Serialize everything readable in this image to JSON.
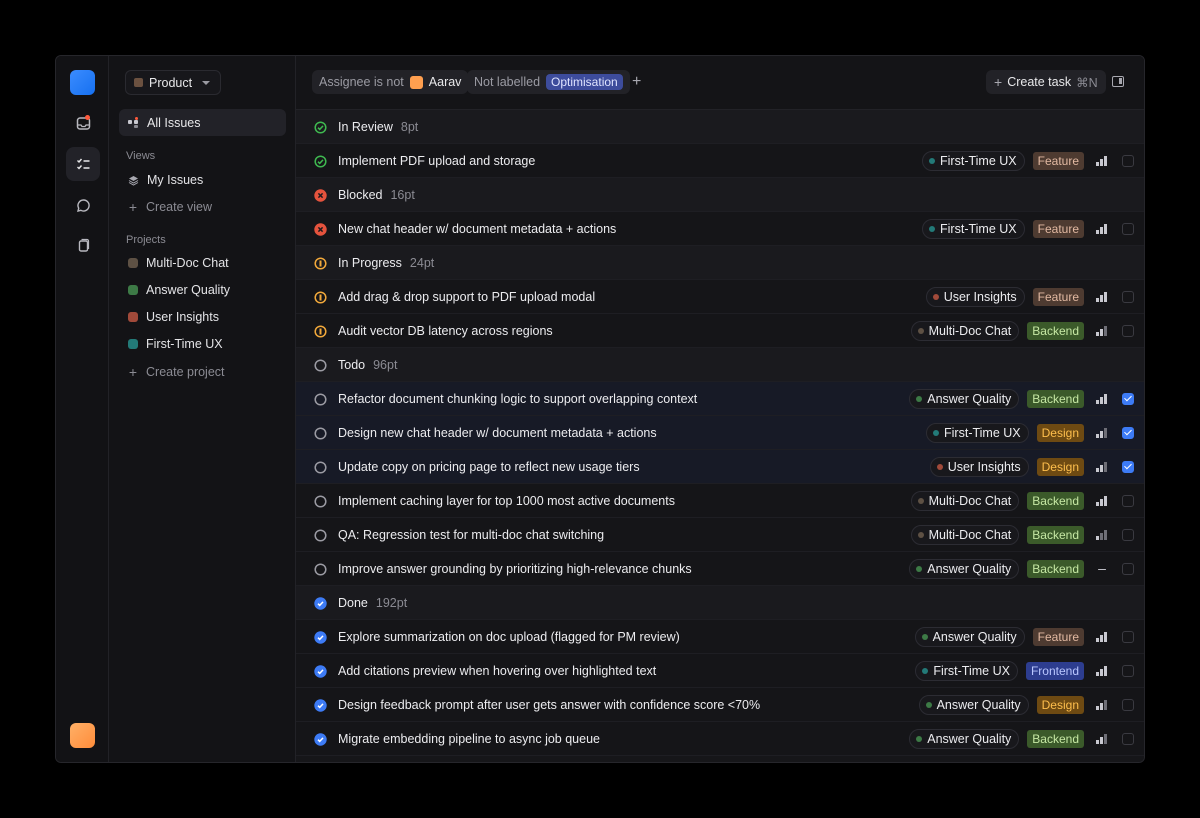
{
  "sidebar": {
    "team": "Product",
    "all_issues": "All Issues",
    "views_label": "Views",
    "my_issues": "My Issues",
    "create_view": "Create view",
    "projects_label": "Projects",
    "projects": [
      {
        "name": "Multi-Doc Chat",
        "color": "#5e5144"
      },
      {
        "name": "Answer Quality",
        "color": "#3d7a46"
      },
      {
        "name": "User Insights",
        "color": "#a14a3a"
      },
      {
        "name": "First-Time UX",
        "color": "#237a78"
      }
    ],
    "create_project": "Create project"
  },
  "toolbar": {
    "filter1_prefix": "Assignee is not",
    "filter1_value": "Aarav",
    "filter2_prefix": "Not labelled",
    "filter2_value": "Optimisation",
    "create_task": "Create task",
    "create_task_kbd": "⌘N"
  },
  "colors": {
    "accent": "#3d7bf5"
  },
  "rows": [
    {
      "kind": "group",
      "status": "review",
      "title": "In Review",
      "points": "8pt"
    },
    {
      "kind": "task",
      "status": "review",
      "title": "Implement PDF upload and storage",
      "project": "First-Time UX",
      "pcolor": "#237a78",
      "label": "Feature",
      "lbl": "feature",
      "prio": 3,
      "checked": false
    },
    {
      "kind": "group",
      "status": "blocked",
      "title": "Blocked",
      "points": "16pt"
    },
    {
      "kind": "task",
      "status": "blocked",
      "title": "New chat header w/ document metadata + actions",
      "project": "First-Time UX",
      "pcolor": "#237a78",
      "label": "Feature",
      "lbl": "feature",
      "prio": 3,
      "checked": false
    },
    {
      "kind": "group",
      "status": "progress",
      "title": "In Progress",
      "points": "24pt"
    },
    {
      "kind": "task",
      "status": "progress",
      "title": "Add drag & drop support to PDF upload modal",
      "project": "User Insights",
      "pcolor": "#a14a3a",
      "label": "Feature",
      "lbl": "feature",
      "prio": 3,
      "checked": false
    },
    {
      "kind": "task",
      "status": "progress",
      "title": "Audit vector DB latency across regions",
      "project": "Multi-Doc Chat",
      "pcolor": "#5e5144",
      "label": "Backend",
      "lbl": "backend",
      "prio": 2,
      "checked": false
    },
    {
      "kind": "group",
      "status": "todo",
      "title": "Todo",
      "points": "96pt"
    },
    {
      "kind": "task",
      "status": "todo",
      "title": "Refactor document chunking logic to support overlapping context",
      "project": "Answer Quality",
      "pcolor": "#3d7a46",
      "label": "Backend",
      "lbl": "backend",
      "prio": 3,
      "checked": true
    },
    {
      "kind": "task",
      "status": "todo",
      "title": "Design new chat header w/ document metadata + actions",
      "project": "First-Time UX",
      "pcolor": "#237a78",
      "label": "Design",
      "lbl": "design",
      "prio": 2,
      "checked": true
    },
    {
      "kind": "task",
      "status": "todo",
      "title": "Update copy on pricing page to reflect new usage tiers",
      "project": "User Insights",
      "pcolor": "#a14a3a",
      "label": "Design",
      "lbl": "design",
      "prio": 2,
      "checked": true
    },
    {
      "kind": "task",
      "status": "todo",
      "title": "Implement caching layer for top 1000 most active documents",
      "project": "Multi-Doc Chat",
      "pcolor": "#5e5144",
      "label": "Backend",
      "lbl": "backend",
      "prio": 3,
      "checked": false
    },
    {
      "kind": "task",
      "status": "todo",
      "title": "QA: Regression test for multi-doc chat switching",
      "project": "Multi-Doc Chat",
      "pcolor": "#5e5144",
      "label": "Backend",
      "lbl": "backend",
      "prio": 1,
      "checked": false
    },
    {
      "kind": "task",
      "status": "todo",
      "title": "Improve answer grounding by prioritizing high-relevance chunks",
      "project": "Answer Quality",
      "pcolor": "#3d7a46",
      "label": "Backend",
      "lbl": "backend",
      "prio": 0,
      "checked": false
    },
    {
      "kind": "group",
      "status": "done",
      "title": "Done",
      "points": "192pt"
    },
    {
      "kind": "task",
      "status": "done",
      "title": "Explore summarization on doc upload (flagged for PM review)",
      "project": "Answer Quality",
      "pcolor": "#3d7a46",
      "label": "Feature",
      "lbl": "feature",
      "prio": 3,
      "checked": false
    },
    {
      "kind": "task",
      "status": "done",
      "title": "Add citations preview when hovering over highlighted text",
      "project": "First-Time UX",
      "pcolor": "#237a78",
      "label": "Frontend",
      "lbl": "frontend",
      "prio": 3,
      "checked": false
    },
    {
      "kind": "task",
      "status": "done",
      "title": "Design feedback prompt after user gets answer with confidence score <70%",
      "project": "Answer Quality",
      "pcolor": "#3d7a46",
      "label": "Design",
      "lbl": "design",
      "prio": 2,
      "checked": false
    },
    {
      "kind": "task",
      "status": "done",
      "title": "Migrate embedding pipeline to async job queue",
      "project": "Answer Quality",
      "pcolor": "#3d7a46",
      "label": "Backend",
      "lbl": "backend",
      "prio": 2,
      "checked": false
    }
  ]
}
